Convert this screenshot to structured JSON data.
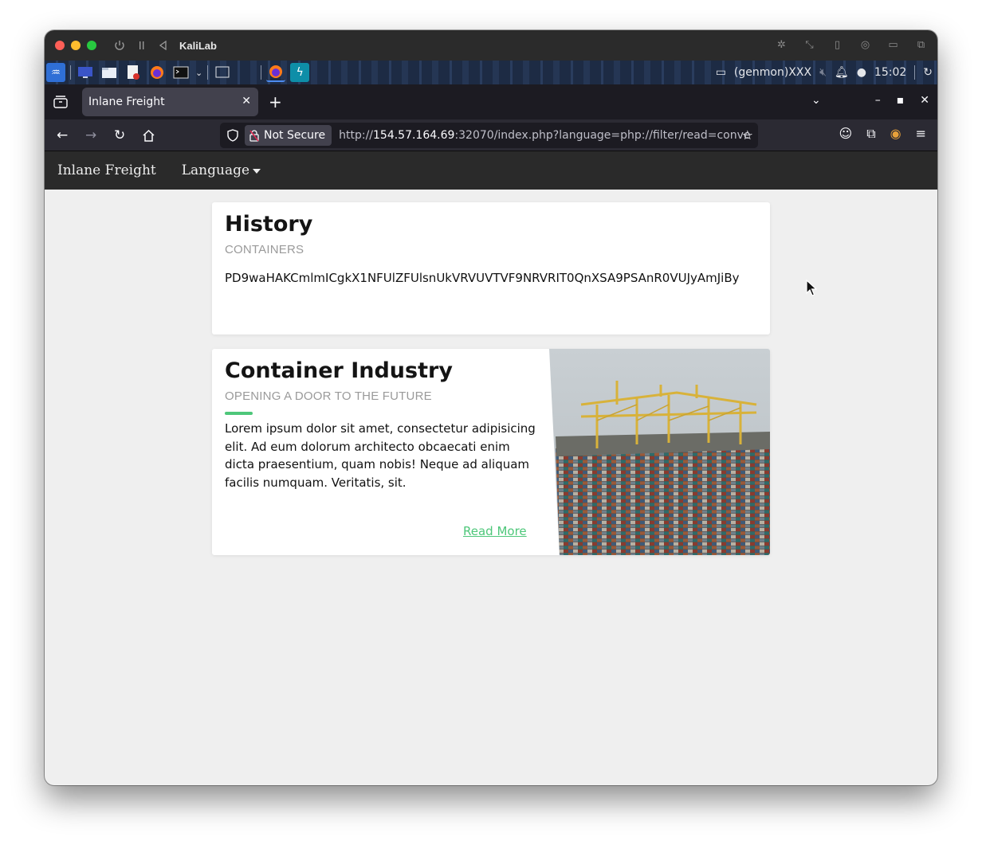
{
  "vm": {
    "title": "KaliLab"
  },
  "panel": {
    "genmon": "(genmon)XXX",
    "clock": "15:02"
  },
  "browser": {
    "tab_title": "Inlane Freight",
    "security_label": "Not Secure",
    "url_scheme": "http://",
    "url_host": "154.57.164.69",
    "url_rest": ":32070/index.php?language=php://filter/read=conve"
  },
  "site": {
    "brand": "Inlane Freight",
    "language_menu": "Language",
    "history": {
      "title": "History",
      "subtitle": "CONTAINERS",
      "content": "PD9waHAKCmlmICgkX1NFUlZFUlsnUkVRVUVTVF9NRVRIT0QnXSA9PSAnR0VUJyAmJiBy"
    },
    "industry": {
      "title": "Container Industry",
      "subtitle": "OPENING A DOOR TO THE FUTURE",
      "body": "Lorem ipsum dolor sit amet, consectetur adipisicing elit. Ad eum dolorum architecto obcaecati enim dicta praesentium, quam nobis! Neque ad aliquam facilis numquam. Veritatis, sit.",
      "read_more": "Read More"
    }
  },
  "colors": {
    "accent": "#4ec77a",
    "site_nav": "#2a2a2a",
    "firefox_chrome": "#2b2a33"
  }
}
